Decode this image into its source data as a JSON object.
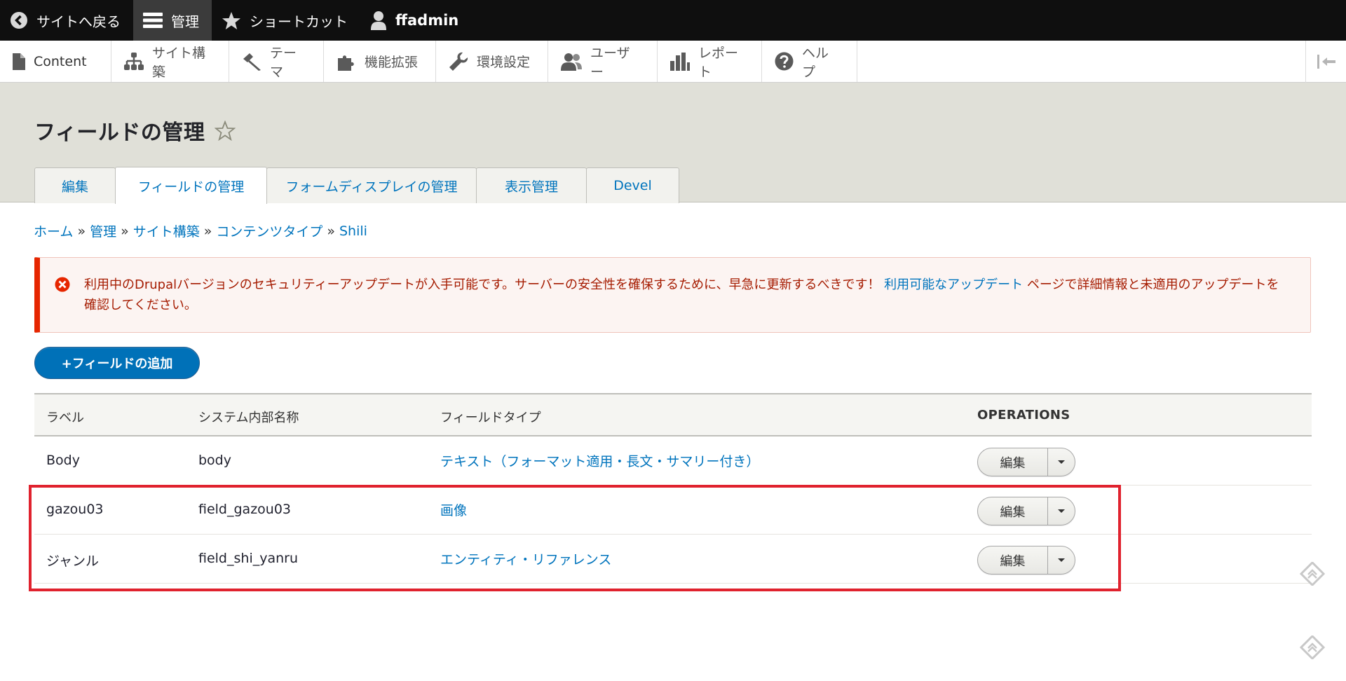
{
  "toolbar": {
    "back_label": "サイトへ戻る",
    "manage_label": "管理",
    "shortcuts_label": "ショートカット",
    "user_label": "ffadmin"
  },
  "admin_menu": {
    "items": [
      {
        "label": "Content",
        "icon": "file-icon"
      },
      {
        "label": "サイト構築",
        "icon": "sitemap-icon"
      },
      {
        "label": "テーマ",
        "icon": "paintbrush-icon"
      },
      {
        "label": "機能拡張",
        "icon": "puzzle-icon"
      },
      {
        "label": "環境設定",
        "icon": "wrench-icon"
      },
      {
        "label": "ユーザー",
        "icon": "people-icon"
      },
      {
        "label": "レポート",
        "icon": "bar-chart-icon"
      },
      {
        "label": "ヘルプ",
        "icon": "help-icon"
      }
    ]
  },
  "page": {
    "title": "フィールドの管理"
  },
  "tabs": [
    {
      "label": "編集"
    },
    {
      "label": "フィールドの管理"
    },
    {
      "label": "フォームディスプレイの管理"
    },
    {
      "label": "表示管理"
    },
    {
      "label": "Devel"
    }
  ],
  "breadcrumb": {
    "items": [
      "ホーム",
      "管理",
      "サイト構築",
      "コンテンツタイプ",
      "Shili"
    ],
    "separator": "»"
  },
  "message": {
    "text_before": "利用中のDrupalバージョンのセキュリティーアップデートが入手可能です。サーバーの安全性を確保するために、早急に更新するべきです！ ",
    "link": "利用可能なアップデート",
    "text_after": " ページで詳細情報と未適用のアップデートを確認してください。"
  },
  "add_field_button": "+フィールドの追加",
  "table": {
    "headers": {
      "label": "ラベル",
      "machine_name": "システム内部名称",
      "field_type": "フィールドタイプ",
      "operations": "OPERATIONS"
    },
    "rows": [
      {
        "label": "Body",
        "machine_name": "body",
        "field_type": "テキスト（フォーマット適用・長文・サマリー付き）",
        "op_label": "編集"
      },
      {
        "label": "gazou03",
        "machine_name": "field_gazou03",
        "field_type": "画像",
        "op_label": "編集"
      },
      {
        "label": "ジャンル",
        "machine_name": "field_shi_yanru",
        "field_type": "エンティティ・リファレンス",
        "op_label": "編集"
      }
    ]
  },
  "colors": {
    "toolbar_bg": "#0f0f0f",
    "link": "#0074bd",
    "error_red": "#e62600",
    "button_blue": "#0071b8",
    "highlight_red": "#e0222e"
  }
}
